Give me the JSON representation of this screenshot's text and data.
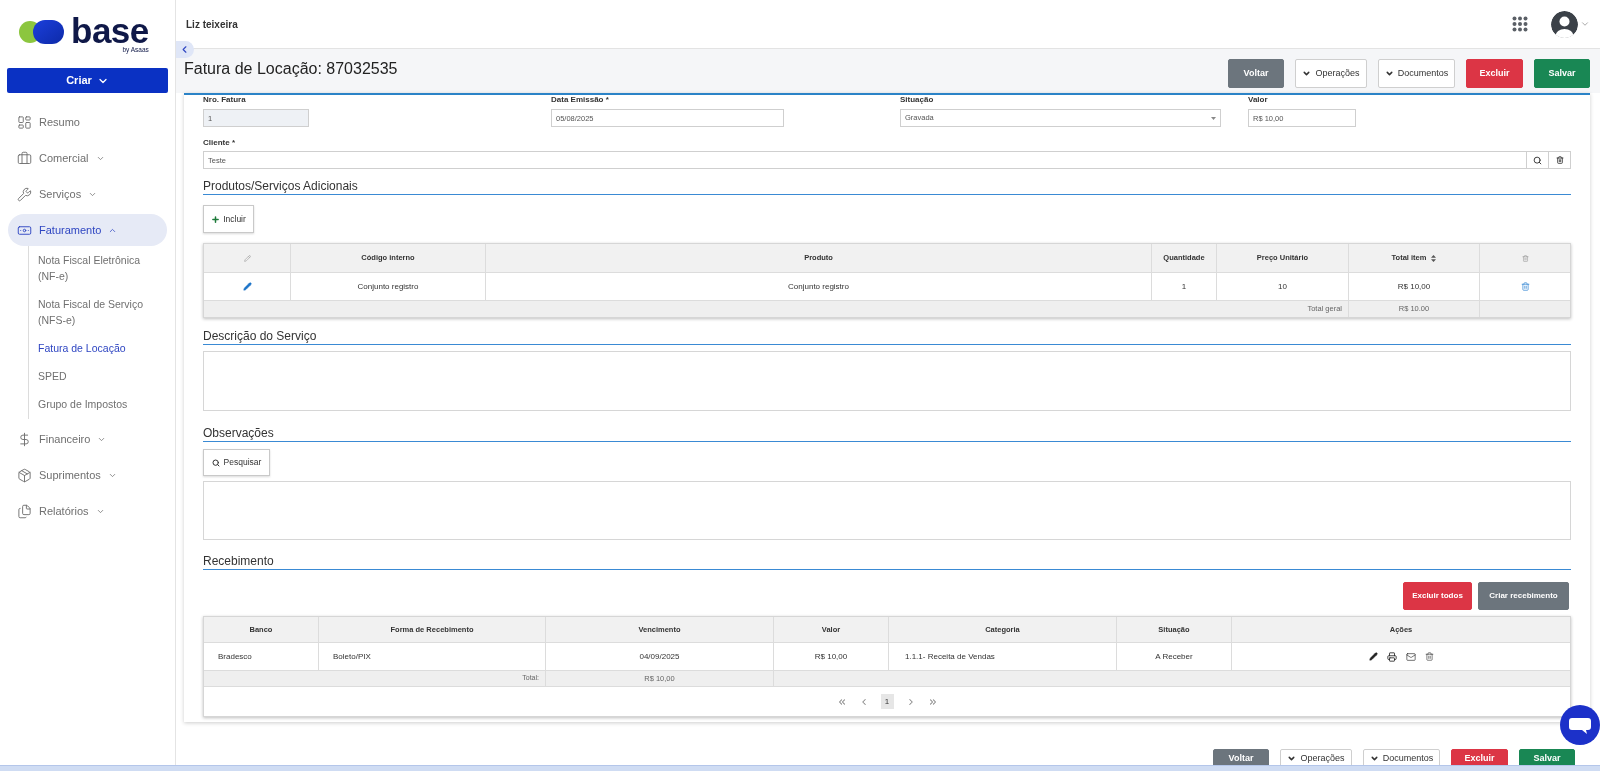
{
  "sidebar": {
    "logo": {
      "wordmark": "base",
      "tagline": "by Asaas"
    },
    "create_button": {
      "label": "Criar"
    },
    "items": [
      {
        "label": "Resumo",
        "selected": false
      },
      {
        "label": "Comercial",
        "selected": false,
        "expanded": false
      },
      {
        "label": "Serviços",
        "selected": false,
        "expanded": false
      },
      {
        "label": "Faturamento",
        "selected": true,
        "expanded": true,
        "children": [
          {
            "label": "Nota Fiscal Eletrônica (NF-e)",
            "selected": false
          },
          {
            "label": "Nota Fiscal de Serviço (NFS-e)",
            "selected": false
          },
          {
            "label": "Fatura de Locação",
            "selected": true
          },
          {
            "label": "SPED",
            "selected": false
          },
          {
            "label": "Grupo de Impostos",
            "selected": false
          }
        ]
      },
      {
        "label": "Financeiro",
        "selected": false,
        "expanded": false
      },
      {
        "label": "Suprimentos",
        "selected": false,
        "expanded": false
      },
      {
        "label": "Relatórios",
        "selected": false,
        "expanded": false
      }
    ]
  },
  "header": {
    "user_name": "Liz teixeira"
  },
  "page": {
    "title": "Fatura de Locação: 87032535",
    "actions": [
      {
        "label": "Voltar",
        "kind": "secondary"
      },
      {
        "label": "Operações",
        "kind": "dropdown"
      },
      {
        "label": "Documentos",
        "kind": "dropdown"
      },
      {
        "label": "Excluir",
        "kind": "danger"
      },
      {
        "label": "Salvar",
        "kind": "success"
      }
    ]
  },
  "form": {
    "fields": [
      {
        "label": "Nro. Fatura",
        "value": "1",
        "kind": "text",
        "disabled": true
      },
      {
        "label": "Data Emissão *",
        "value": "05/08/2025",
        "kind": "text",
        "disabled": false
      },
      {
        "label": "Situação",
        "value": "Gravada",
        "kind": "select",
        "disabled": false
      },
      {
        "label": "Valor",
        "value": "R$ 10,00",
        "kind": "text",
        "disabled": false
      }
    ],
    "client": {
      "label": "Cliente *",
      "value": "Teste"
    }
  },
  "products": {
    "title": "Produtos/Serviços Adicionais",
    "add_button": "Incluir",
    "columns": [
      {
        "label": "Código interno",
        "sortable": false
      },
      {
        "label": "Produto",
        "sortable": false
      },
      {
        "label": "Quantidade",
        "sortable": false
      },
      {
        "label": "Preço Unitário",
        "sortable": false
      },
      {
        "label": "Total item",
        "sortable": true
      }
    ],
    "rows": [
      {
        "cells": [
          "Conjunto registro",
          "Conjunto registro",
          "1",
          "10",
          "R$ 10,00"
        ]
      }
    ],
    "footer": {
      "label": "Total geral",
      "value": "R$ 10.00"
    }
  },
  "description": {
    "title": "Descrição do Serviço"
  },
  "notes": {
    "title": "Observações",
    "search_button": "Pesquisar"
  },
  "receipts": {
    "title": "Recebimento",
    "buttons": [
      {
        "label": "Excluir todos",
        "kind": "danger"
      },
      {
        "label": "Criar recebimento",
        "kind": "secondary"
      }
    ],
    "columns": [
      "Banco",
      "Forma de Recebimento",
      "Vencimento",
      "Valor",
      "Categoria",
      "Situação",
      "Ações"
    ],
    "rows": [
      {
        "cells": [
          "Bradesco",
          "Boleto/PIX",
          "04/09/2025",
          "R$ 10,00",
          "1.1.1- Receita de Vendas",
          "A Receber"
        ]
      }
    ],
    "total": {
      "label": "Total:",
      "value": "R$ 10,00"
    },
    "pages": [
      {
        "label": "1",
        "selected": true
      }
    ]
  },
  "footer_actions": [
    {
      "label": "Voltar",
      "kind": "secondary"
    },
    {
      "label": "Operações",
      "kind": "dropdown"
    },
    {
      "label": "Documentos",
      "kind": "dropdown"
    },
    {
      "label": "Excluir",
      "kind": "danger"
    },
    {
      "label": "Salvar",
      "kind": "success"
    }
  ]
}
